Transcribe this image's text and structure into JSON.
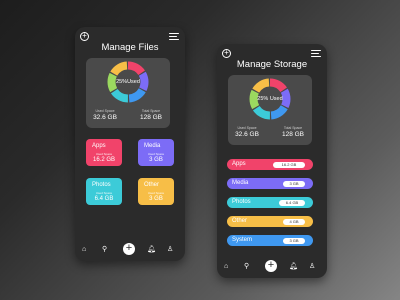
{
  "manage_files": {
    "title": "Manage Files",
    "usage_label": "25%Used",
    "used_space_label": "Used Space",
    "used_space_value": "32.6 GB",
    "total_space_label": "Total Space",
    "total_space_value": "128 GB",
    "tiles": [
      {
        "name": "Apps",
        "sub": "Used Space",
        "size": "16.2 GB",
        "color": "#f1436a"
      },
      {
        "name": "Media",
        "sub": "Used Space",
        "size": "3 GB",
        "color": "#7c6cf6"
      },
      {
        "name": "Photos",
        "sub": "Used Space",
        "size": "6.4 GB",
        "color": "#3ccbd8"
      },
      {
        "name": "Other",
        "sub": "Used Space",
        "size": "3 GB",
        "color": "#f7be47"
      }
    ]
  },
  "manage_storage": {
    "title": "Manage Storage",
    "usage_label": "25% Used",
    "used_space_label": "Used Space",
    "used_space_value": "32.6 GB",
    "total_space_label": "Total Space",
    "total_space_value": "128 GB",
    "bars": [
      {
        "name": "Apps",
        "size": "16.2 GB",
        "color": "#f1436a"
      },
      {
        "name": "Media",
        "size": "3 GB",
        "color": "#7c6cf6"
      },
      {
        "name": "Photos",
        "size": "6.4 GB",
        "color": "#3ccbd8"
      },
      {
        "name": "Other",
        "size": "4 GB",
        "color": "#f7be47"
      },
      {
        "name": "System",
        "size": "3 GB",
        "color": "#3f98f0"
      }
    ]
  },
  "donut_colors": [
    "#f1436a",
    "#7c6cf6",
    "#3f98f0",
    "#3ccbd8",
    "#9bd95f",
    "#f7be47"
  ],
  "icons": [
    "plus-circle-icon",
    "menu-icon",
    "home-icon",
    "search-icon",
    "add-icon",
    "bell-icon",
    "user-icon"
  ]
}
